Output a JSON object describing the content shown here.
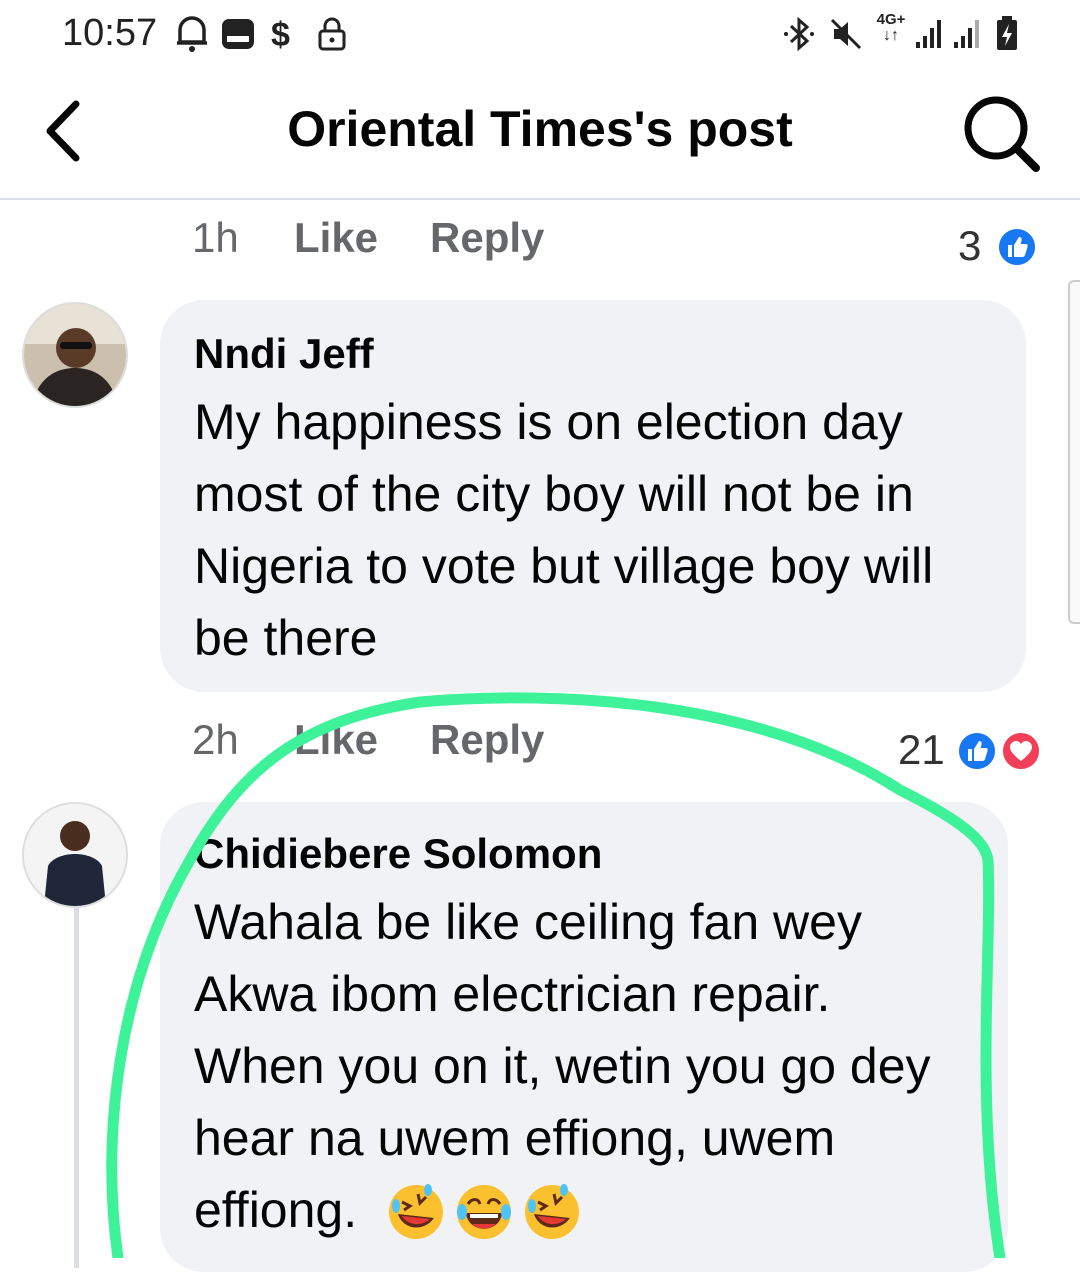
{
  "status_bar": {
    "time": "10:57",
    "network": "4G+"
  },
  "header": {
    "title": "Oriental Times's post"
  },
  "comments": [
    {
      "action_time": "1h",
      "like": "Like",
      "reply": "Reply",
      "reactions": "3"
    },
    {
      "author": "Nndi Jeff",
      "lines": [
        "My happiness is on election day",
        "most of the city boy will not be in",
        "Nigeria to vote but village boy will",
        "be there"
      ],
      "action_time": "2h",
      "like": "Like",
      "reply": "Reply",
      "reactions": "21"
    },
    {
      "author": "Chidiebere Solomon",
      "lines": [
        "Wahala be like ceiling fan wey",
        "Akwa ibom electrician repair.",
        "When you on it, wetin you go dey",
        "hear na uwem effiong, uwem",
        "effiong."
      ]
    }
  ],
  "colors": {
    "like_blue": "#1877f2",
    "love_red": "#f33e58",
    "highlight_green": "#3ef29a"
  }
}
